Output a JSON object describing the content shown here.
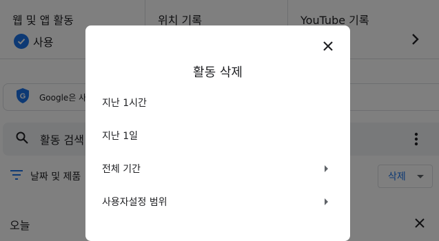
{
  "controls": {
    "web_app_activity": {
      "title": "웹 및 앱 활동",
      "status": "사용"
    },
    "location_history": {
      "title": "위치 기록"
    },
    "youtube_history": {
      "title": "YouTube 기록"
    }
  },
  "notice": {
    "text": "Google은 사"
  },
  "search": {
    "placeholder": "활동 검색"
  },
  "filter": {
    "label": "날짜 및 제품"
  },
  "delete_dropdown": {
    "label": "삭제"
  },
  "section": {
    "title": "오늘"
  },
  "dialog": {
    "title": "활동 삭제",
    "options": [
      {
        "label": "지난 1시간"
      },
      {
        "label": "지난 1일"
      },
      {
        "label": "전체 기간"
      },
      {
        "label": "사용자설정 범위"
      }
    ]
  },
  "colors": {
    "accent": "#1a73e8",
    "scrim": "rgba(0,0,0,0.5)"
  }
}
